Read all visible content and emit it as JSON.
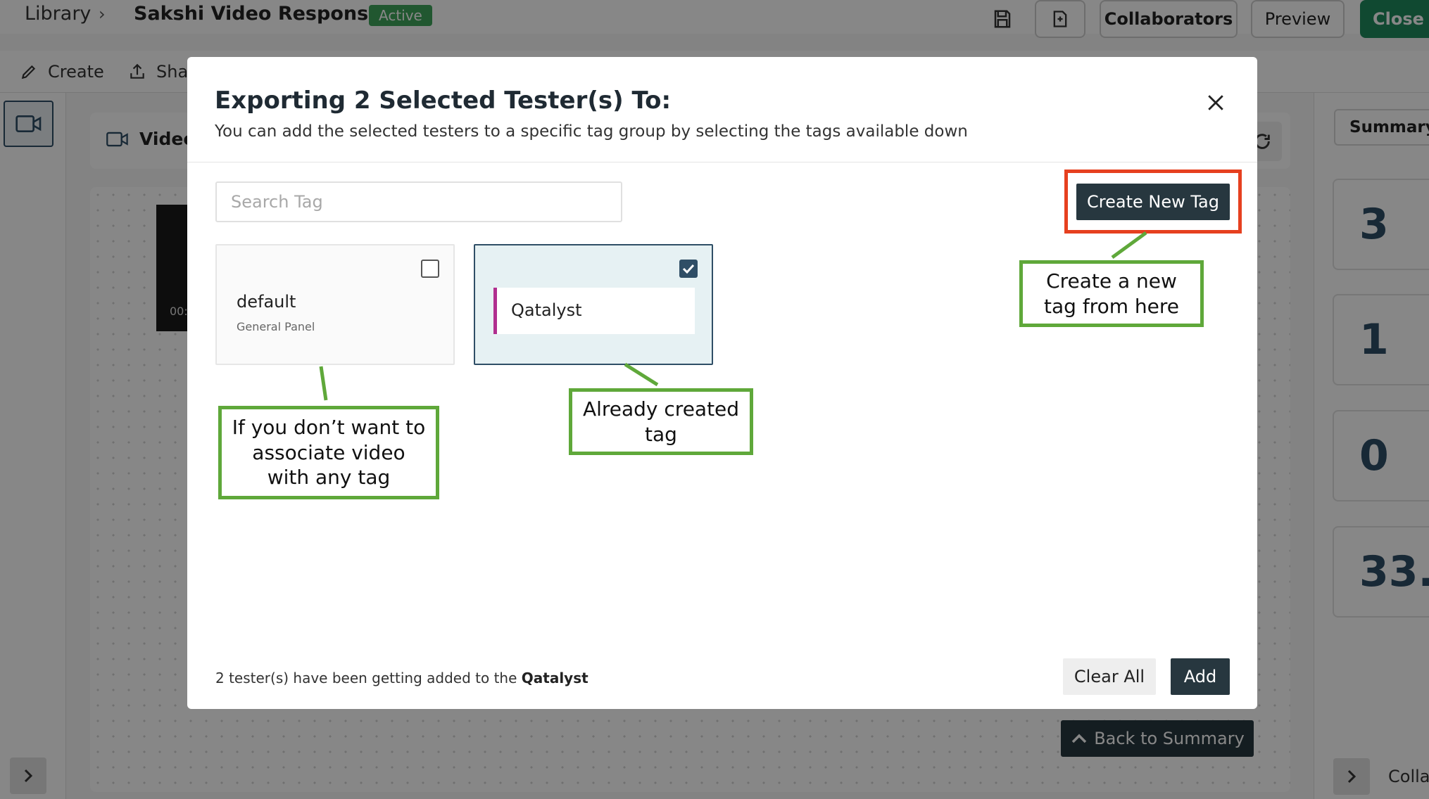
{
  "header": {
    "breadcrumb_root": "Library",
    "breadcrumb_separator": "›",
    "title": "Sakshi Video Response",
    "status": "Active",
    "collaborators_label": "Collaborators",
    "preview_label": "Preview",
    "close_label": "Close"
  },
  "toolbar": {
    "create_label": "Create",
    "share_label": "Sha"
  },
  "content": {
    "video_tab_label": "Video",
    "video_timestamp": "00:",
    "back_to_summary_label": "Back to Summary"
  },
  "summary_panel": {
    "tab_label": "Summary",
    "metrics": [
      "3",
      "1",
      "0",
      "33.:"
    ],
    "collaborators_label": "Colla"
  },
  "modal": {
    "title": "Exporting 2 Selected Tester(s) To:",
    "subtitle": "You can add the selected testers to a specific tag group by selecting the tags available down",
    "search_placeholder": "Search Tag",
    "create_tag_label": "Create New Tag",
    "tags": [
      {
        "name": "default",
        "subtitle": "General Panel",
        "checked": false
      },
      {
        "name": "Qatalyst",
        "subtitle": "",
        "checked": true
      }
    ],
    "footer_prefix": "2 tester(s) have been getting added to the",
    "footer_tag": "Qatalyst",
    "clear_all_label": "Clear All",
    "add_label": "Add"
  },
  "annotations": {
    "default_note": "If you don’t want to associate video with any tag",
    "existing_note": "Already created tag",
    "create_note": "Create a new tag from here"
  },
  "colors": {
    "primary_dark": "#27373f",
    "active_green": "#3fa45b",
    "highlight_red": "#e6401f",
    "callout_green": "#5fa83a",
    "tag_accent": "#b12f8f"
  }
}
